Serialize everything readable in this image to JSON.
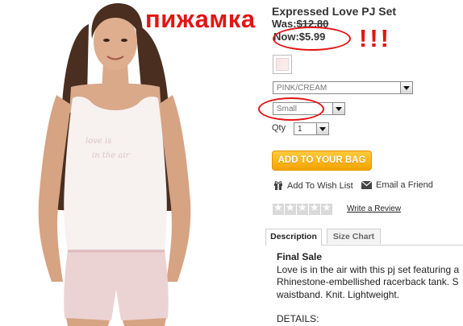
{
  "annotations": {
    "title_word": "пижамка",
    "exclaim": "!!!",
    "color": "#e31414"
  },
  "product": {
    "name": "Expressed Love PJ Set",
    "was_label": "Was:",
    "was_price": "$12.80",
    "now_label": "Now:",
    "now_price": "$5.99"
  },
  "options": {
    "color_value": "PINK/CREAM",
    "size_value": "Small",
    "qty_label": "Qty",
    "qty_value": "1"
  },
  "actions": {
    "add_to_bag": "ADD TO YOUR BAG",
    "wish_list": "Add To Wish List",
    "email_friend": "Email a Friend",
    "write_review": "Write a Review",
    "button_color": "#f4a300"
  },
  "rating": {
    "stars_filled": 0,
    "stars_total": 5
  },
  "tabs": [
    {
      "label": "Description",
      "active": true
    },
    {
      "label": "Size Chart",
      "active": false
    }
  ],
  "description": {
    "heading": "Final Sale",
    "lines": [
      "Love is in the air with this pj set featuring a",
      "Rhinestone-embellished racerback tank. S",
      "waistband. Knit. Lightweight."
    ],
    "details_label": "DETAILS:"
  }
}
